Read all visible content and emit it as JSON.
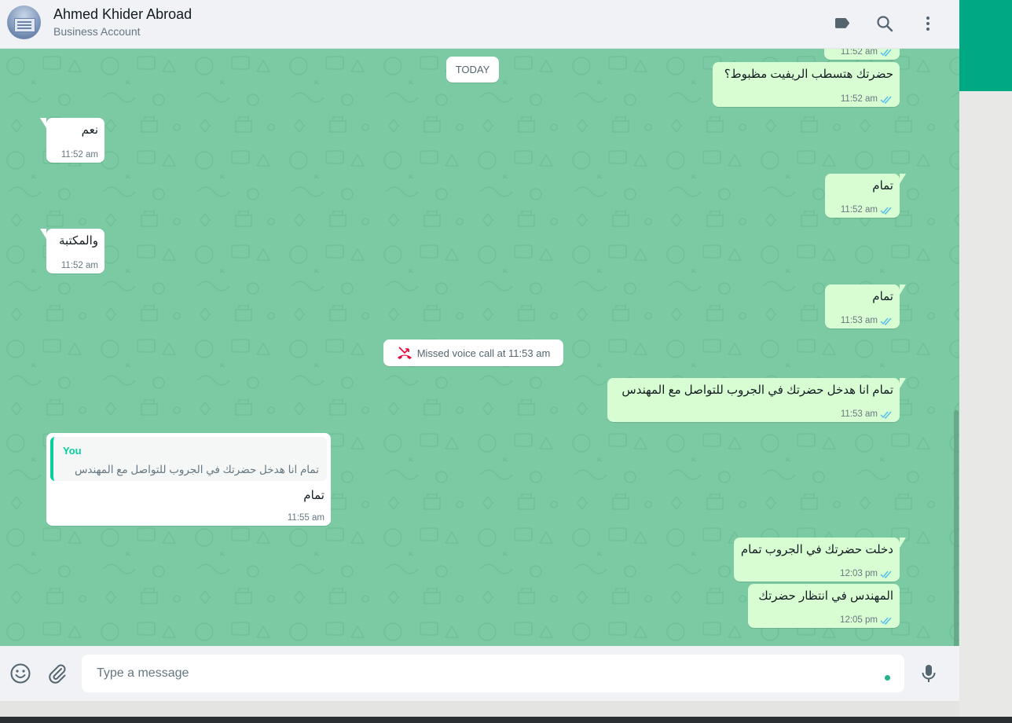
{
  "header": {
    "contact_name": "Ahmed Khider Abroad",
    "subtitle": "Business Account",
    "icons": [
      "label-icon",
      "search-icon",
      "menu-icon"
    ]
  },
  "date_divider": "TODAY",
  "messages": [
    {
      "dir": "out",
      "text": "",
      "time": "11:52 am",
      "read": true
    },
    {
      "dir": "out",
      "text": "حضرتك هتسطب الريفيت مظبوط؟",
      "time": "11:52 am",
      "read": true
    },
    {
      "dir": "in",
      "text": "نعم",
      "time": "11:52 am"
    },
    {
      "dir": "out",
      "text": "تمام",
      "time": "11:52 am",
      "read": true
    },
    {
      "dir": "in",
      "text": "والمكتبة",
      "time": "11:52 am"
    },
    {
      "dir": "out",
      "text": "تمام",
      "time": "11:53 am",
      "read": true
    },
    {
      "dir": "out",
      "text": "تمام انا هدخل حضرتك في الجروب للتواصل مع المهندس",
      "time": "11:53 am",
      "read": true
    },
    {
      "dir": "in",
      "text": "تمام",
      "time": "11:55 am",
      "quoted_author": "You",
      "quoted_text": "تمام انا هدخل حضرتك في الجروب للتواصل مع المهندس"
    },
    {
      "dir": "out",
      "text": "دخلت حضرتك في الجروب تمام",
      "time": "12:03 pm",
      "read": true
    },
    {
      "dir": "out",
      "text": "المهندس في انتظار حضرتك",
      "time": "12:05 pm",
      "read": true
    }
  ],
  "system_message": {
    "text": "Missed voice call at 11:53 am",
    "icon": "missed-call-icon"
  },
  "composer": {
    "placeholder": "Type a message",
    "icons": [
      "emoji-icon",
      "attach-icon",
      "mic-icon"
    ]
  },
  "colors": {
    "accent": "#00a884",
    "chat_bg": "#7ccaa4",
    "outgoing_bubble": "#d9fdd3",
    "incoming_bubble": "#ffffff",
    "read_ticks": "#53bdeb",
    "missed_call": "#ea0038"
  }
}
